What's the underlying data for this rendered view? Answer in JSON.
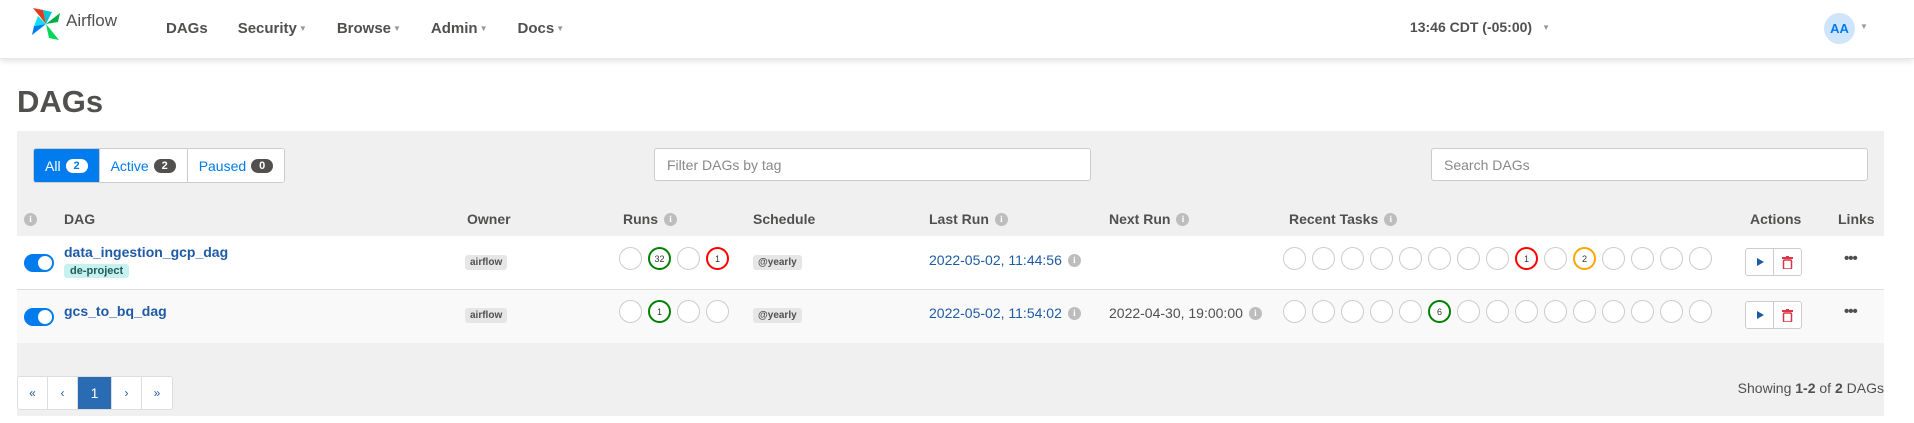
{
  "brand": {
    "name": "Airflow"
  },
  "nav": {
    "items": [
      {
        "label": "DAGs",
        "has_menu": false
      },
      {
        "label": "Security",
        "has_menu": true
      },
      {
        "label": "Browse",
        "has_menu": true
      },
      {
        "label": "Admin",
        "has_menu": true
      },
      {
        "label": "Docs",
        "has_menu": true
      }
    ],
    "clock": "13:46 CDT (-05:00)",
    "avatar_initials": "AA"
  },
  "page": {
    "title": "DAGs"
  },
  "filters": {
    "status": [
      {
        "label": "All",
        "count": "2",
        "active": true
      },
      {
        "label": "Active",
        "count": "2",
        "active": false
      },
      {
        "label": "Paused",
        "count": "0",
        "active": false
      }
    ],
    "tag_placeholder": "Filter DAGs by tag",
    "search_placeholder": "Search DAGs"
  },
  "table": {
    "headers": {
      "dag": "DAG",
      "owner": "Owner",
      "runs": "Runs",
      "schedule": "Schedule",
      "last_run": "Last Run",
      "next_run": "Next Run",
      "recent_tasks": "Recent Tasks",
      "actions": "Actions",
      "links": "Links"
    },
    "rows": [
      {
        "dag_id": "data_ingestion_gcp_dag",
        "tag": "de-project",
        "owner": "airflow",
        "runs": [
          {
            "state": "queued",
            "count": ""
          },
          {
            "state": "success",
            "count": "32"
          },
          {
            "state": "running",
            "count": ""
          },
          {
            "state": "failed",
            "count": "1"
          }
        ],
        "schedule": "@yearly",
        "last_run": "2022-05-02, 11:44:56",
        "next_run": "",
        "recent_tasks": [
          {
            "state": "none",
            "count": ""
          },
          {
            "state": "removed",
            "count": ""
          },
          {
            "state": "scheduled",
            "count": ""
          },
          {
            "state": "queued",
            "count": ""
          },
          {
            "state": "running",
            "count": ""
          },
          {
            "state": "success",
            "count": ""
          },
          {
            "state": "shutdown",
            "count": ""
          },
          {
            "state": "restarting",
            "count": ""
          },
          {
            "state": "failed",
            "count": "1"
          },
          {
            "state": "up_for_retry",
            "count": ""
          },
          {
            "state": "up_for_reschedule",
            "count": "2"
          },
          {
            "state": "upstream_failed",
            "count": ""
          },
          {
            "state": "skipped",
            "count": ""
          },
          {
            "state": "sensing",
            "count": ""
          },
          {
            "state": "deferred",
            "count": ""
          }
        ]
      },
      {
        "dag_id": "gcs_to_bq_dag",
        "tag": "",
        "owner": "airflow",
        "runs": [
          {
            "state": "queued",
            "count": ""
          },
          {
            "state": "success",
            "count": "1"
          },
          {
            "state": "running",
            "count": ""
          },
          {
            "state": "failed",
            "count": ""
          }
        ],
        "schedule": "@yearly",
        "last_run": "2022-05-02, 11:54:02",
        "next_run": "2022-04-30, 19:00:00",
        "recent_tasks": [
          {
            "state": "none",
            "count": ""
          },
          {
            "state": "removed",
            "count": ""
          },
          {
            "state": "scheduled",
            "count": ""
          },
          {
            "state": "queued",
            "count": ""
          },
          {
            "state": "running",
            "count": ""
          },
          {
            "state": "success",
            "count": "6"
          },
          {
            "state": "shutdown",
            "count": ""
          },
          {
            "state": "restarting",
            "count": ""
          },
          {
            "state": "failed",
            "count": ""
          },
          {
            "state": "up_for_retry",
            "count": ""
          },
          {
            "state": "up_for_reschedule",
            "count": ""
          },
          {
            "state": "upstream_failed",
            "count": ""
          },
          {
            "state": "skipped",
            "count": ""
          },
          {
            "state": "sensing",
            "count": ""
          },
          {
            "state": "deferred",
            "count": ""
          }
        ]
      }
    ]
  },
  "pagination": {
    "first": "«",
    "prev": "‹",
    "current": "1",
    "next": "›",
    "last": "»"
  },
  "footer": {
    "showing_prefix": "Showing ",
    "showing_range": "1-2",
    "showing_of": " of ",
    "showing_total": "2",
    "showing_suffix": " DAGs"
  },
  "colors": {
    "primary": "#017cee",
    "success": "#008000",
    "failed": "#ff0000",
    "warning": "#ffa500",
    "link": "#1f5aa6",
    "text": "#51504f"
  },
  "icons": {
    "info": "info-icon",
    "play": "play-icon",
    "delete": "trash-icon",
    "links": "ellipsis-icon",
    "logo": "airflow-pinwheel-logo"
  }
}
